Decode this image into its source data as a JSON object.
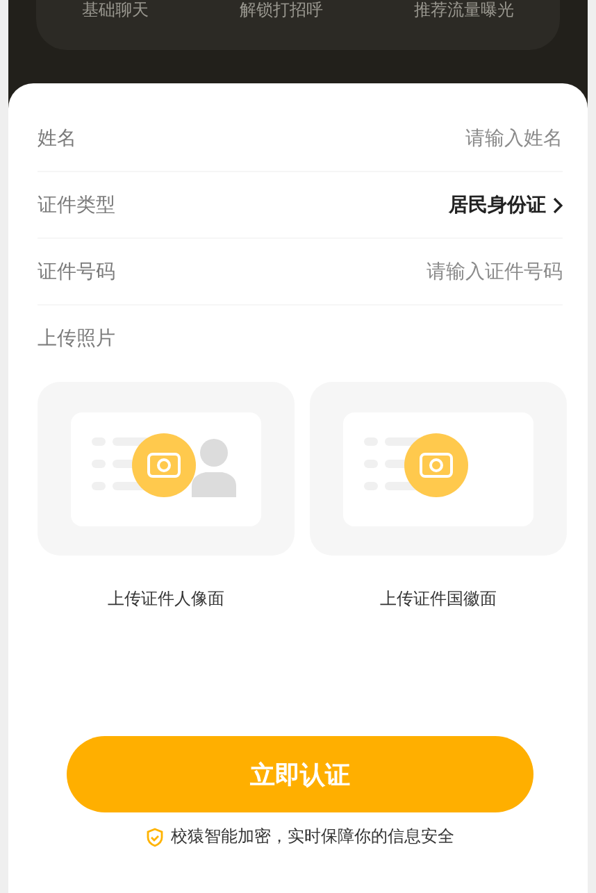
{
  "benefits": [
    "基础聊天",
    "解锁打招呼",
    "推荐流量曝光"
  ],
  "form": {
    "fields": [
      {
        "kind": "input",
        "label": "姓名",
        "placeholder": "请输入姓名"
      },
      {
        "kind": "select",
        "label": "证件类型",
        "value": "居民身份证"
      },
      {
        "kind": "input",
        "label": "证件号码",
        "placeholder": "请输入证件号码"
      }
    ],
    "upload_title": "上传照片",
    "uploads": [
      {
        "kind": "portrait",
        "label": "上传证件人像面"
      },
      {
        "kind": "emblem",
        "label": "上传证件国徽面"
      }
    ]
  },
  "submit": "立即认证",
  "security_note": "校猿智能加密，实时保障你的信息安全"
}
